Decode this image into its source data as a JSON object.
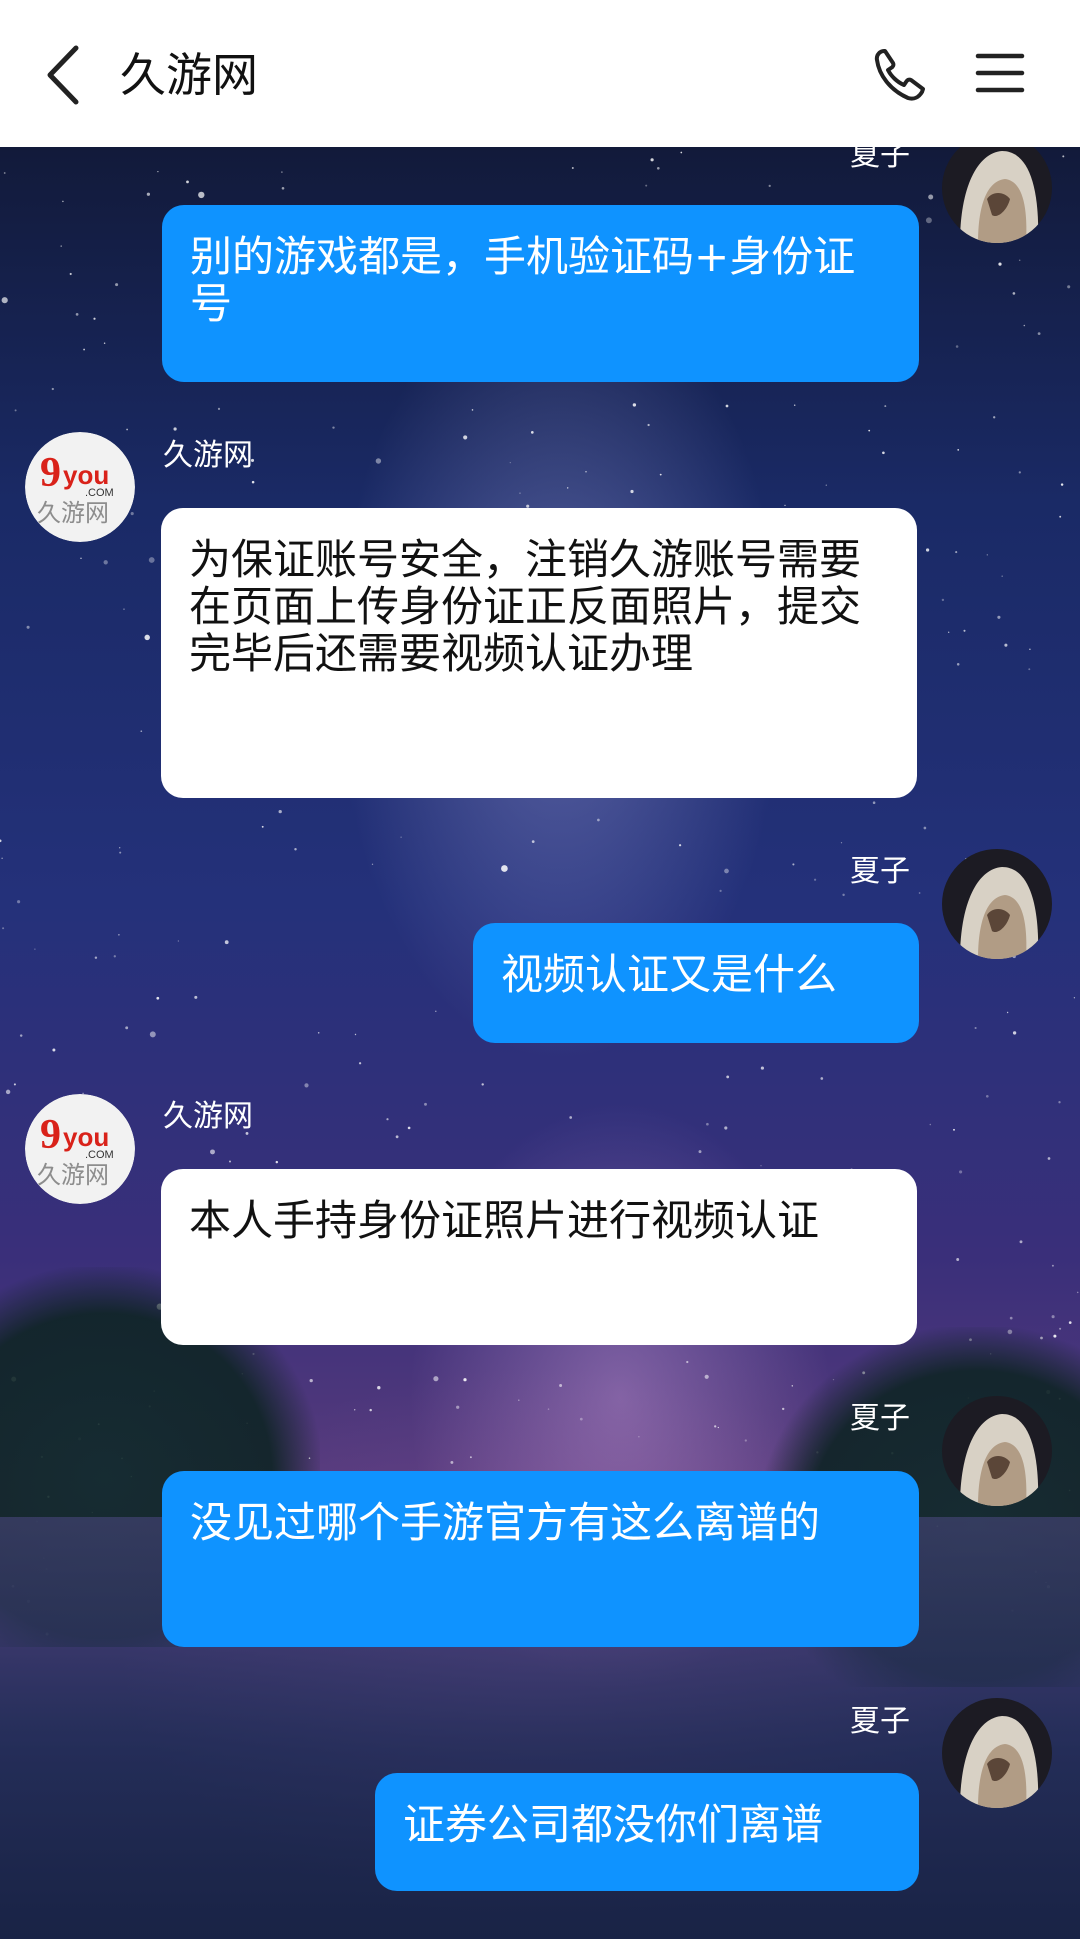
{
  "header": {
    "title": "久游网"
  },
  "icons": {
    "back": "chevron-left-icon",
    "phone": "phone-icon",
    "menu": "menu-icon"
  },
  "colors": {
    "self_bubble": "#0f93ff",
    "other_bubble": "#ffffff",
    "header_bg": "#ffffff"
  },
  "messages": [
    {
      "sender": "夏子",
      "side": "right",
      "text": "别的游戏都是，手机验证码+身份证号"
    },
    {
      "sender": "久游网",
      "side": "left",
      "text": "为保证账号安全，注销久游账号需要在页面上传身份证正反面照片，提交完毕后还需要视频认证办理"
    },
    {
      "sender": "夏子",
      "side": "right",
      "text": "视频认证又是什么"
    },
    {
      "sender": "久游网",
      "side": "left",
      "text": "本人手持身份证照片进行视频认证"
    },
    {
      "sender": "夏子",
      "side": "right",
      "text": "没见过哪个手游官方有这么离谱的"
    },
    {
      "sender": "夏子",
      "side": "right",
      "text": "证券公司都没你们离谱"
    }
  ],
  "logo": {
    "mark": "9you",
    "domain": ".COM",
    "brand": "久游网"
  }
}
